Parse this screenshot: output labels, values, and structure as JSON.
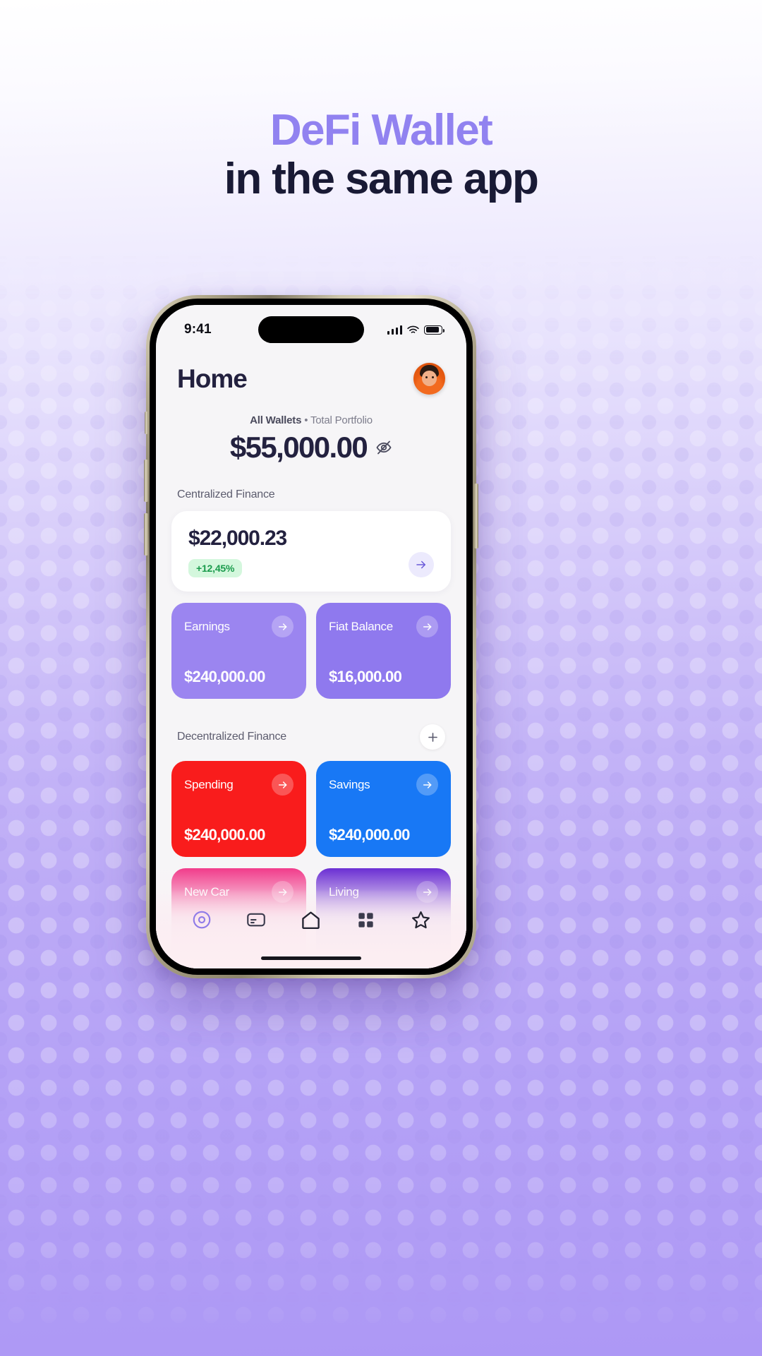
{
  "hero": {
    "line1": "DeFi Wallet",
    "line2": "in the same app",
    "line1_color": "#9182f0",
    "line2_color": "#191a35"
  },
  "phone": {
    "status_bar": {
      "time": "9:41",
      "signal_icon": "cellular-signal-icon",
      "wifi_icon": "wifi-icon",
      "battery_icon": "battery-icon"
    },
    "home_indicator": "home-indicator"
  },
  "app": {
    "header": {
      "title": "Home",
      "avatar": "user-avatar"
    },
    "portfolio": {
      "scope": "All Wallets",
      "separator": "•",
      "label": "Total Portfolio",
      "amount": "$55,000.00",
      "hide_icon": "eye-off-icon"
    },
    "cefi": {
      "section_label": "Centralized Finance",
      "card": {
        "amount": "$22,000.23",
        "change": "+12,45%",
        "change_bg": "#d4f7dd",
        "change_color": "#1a9b4c",
        "arrow_icon": "arrow-right-icon"
      },
      "tiles": [
        {
          "name": "Earnings",
          "amount": "$240,000.00",
          "color": "#9b85f0",
          "arrow_icon": "arrow-right-icon"
        },
        {
          "name": "Fiat Balance",
          "amount": "$16,000.00",
          "color": "#8f79ee",
          "arrow_icon": "arrow-right-icon"
        }
      ]
    },
    "defi": {
      "section_label": "Decentralized Finance",
      "add_icon": "plus-icon",
      "tiles": [
        {
          "name": "Spending",
          "amount": "$240,000.00",
          "color": "#f91c1c",
          "arrow_icon": "arrow-right-icon"
        },
        {
          "name": "Savings",
          "amount": "$240,000.00",
          "color": "#1878f5",
          "arrow_icon": "arrow-right-icon"
        },
        {
          "name": "New Car",
          "amount": "",
          "color": "#f0267e",
          "arrow_icon": "arrow-right-icon"
        },
        {
          "name": "Living",
          "amount": "",
          "color": "#5a18cf",
          "arrow_icon": "arrow-right-icon"
        }
      ]
    },
    "tabbar": [
      {
        "icon": "target-circle-icon",
        "active": true
      },
      {
        "icon": "card-icon",
        "active": false
      },
      {
        "icon": "home-icon",
        "active": false
      },
      {
        "icon": "grid-apps-icon",
        "active": false
      },
      {
        "icon": "star-icon",
        "active": false
      }
    ]
  }
}
